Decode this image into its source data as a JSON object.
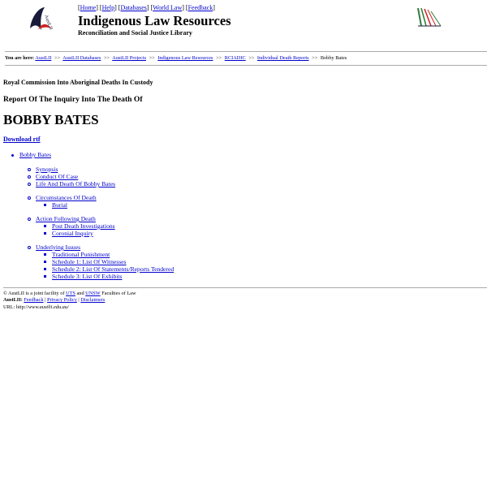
{
  "header": {
    "nav": [
      "Home",
      "Help",
      "Databases",
      "World Law",
      "Feedback"
    ],
    "title": "Indigenous Law Resources",
    "subtitle": "Reconciliation and Social Justice Library",
    "logo_text": "AustLII"
  },
  "breadcrumb": {
    "prefix": "You are here:",
    "separator": ">>",
    "links": [
      "AustLII",
      "AustLII Databases",
      "AustLII Projects",
      "Indigenous Law Resources",
      "RCIADIC",
      "Individual Death Reports"
    ],
    "current": "Bobby Bates"
  },
  "document": {
    "commission": "Royal Commission Into Aboriginal Deaths In Custody",
    "report_title": "Report Of The Inquiry Into The Death Of",
    "person_name": "BOBBY BATES",
    "download": "Download rtf"
  },
  "toc": {
    "root": "Bobby Bates",
    "sections": [
      {
        "label": "Synopsis"
      },
      {
        "label": "Conduct Of Case"
      },
      {
        "label": "Life And Death Of Bobby Bates"
      },
      {
        "label": "Circumstances Of Death",
        "children": [
          "Burial"
        ]
      },
      {
        "label": "Action Following Death",
        "children": [
          "Post Death Investigations",
          "Coronial Inquiry"
        ]
      },
      {
        "label": "Underlying Issues",
        "children": [
          "Traditional Punishment",
          "Schedule 1: List Of Witnesses",
          "Schedule 2: List Of Statements/Reports Tendered",
          "Schedule 3: List Of Exhibits"
        ]
      }
    ]
  },
  "footer": {
    "line1_pre": "© AustLII is a joint facility of",
    "uts": "UTS",
    "and": "and",
    "unsw": "UNSW",
    "line1_post": "Faculties of Law",
    "line2_label": "AustLII:",
    "links": [
      "Feedback",
      "Privacy Policy",
      "Disclaimers"
    ],
    "url_label": "URL: http://",
    "url": "www.austlii.edu.au/"
  },
  "colors": {
    "link": "#0000cc",
    "logo_red": "#cc2222",
    "logo_dark": "#1a1a3a",
    "logo_green": "#2f7a3a"
  }
}
